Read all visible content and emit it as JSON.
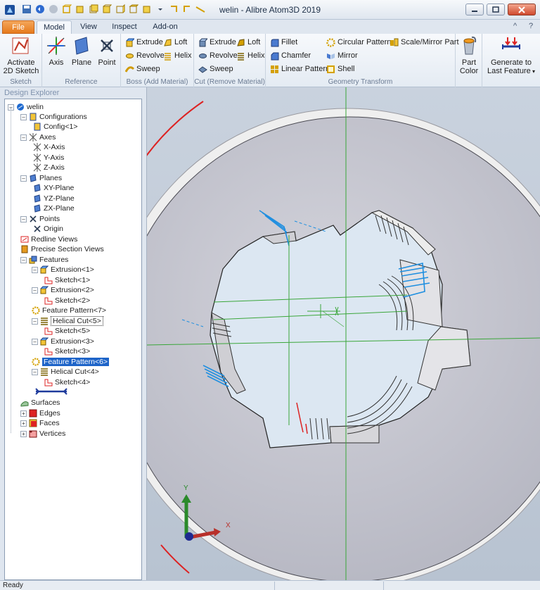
{
  "window": {
    "title": "welin - Alibre Atom3D 2019"
  },
  "tabs": [
    {
      "label": "File"
    },
    {
      "label": "Model"
    },
    {
      "label": "View"
    },
    {
      "label": "Inspect"
    },
    {
      "label": "Add-on"
    }
  ],
  "ribbon": {
    "help_glyph": "?",
    "minimize_glyph": "^",
    "sketch": {
      "label": "Sketch",
      "activate_line1": "Activate",
      "activate_line2": "2D Sketch"
    },
    "reference": {
      "label": "Reference",
      "axis": "Axis",
      "plane": "Plane",
      "point": "Point"
    },
    "boss": {
      "label": "Boss (Add Material)",
      "extrude": "Extrude",
      "loft": "Loft",
      "revolve": "Revolve",
      "helix": "Helix",
      "sweep": "Sweep"
    },
    "cut": {
      "label": "Cut (Remove Material)",
      "extrude": "Extrude",
      "loft": "Loft",
      "revolve": "Revolve",
      "helix": "Helix",
      "sweep": "Sweep"
    },
    "transform": {
      "label": "Geometry Transform",
      "fillet": "Fillet",
      "chamfer": "Chamfer",
      "linear_pattern": "Linear Pattern",
      "circular_pattern": "Circular Pattern",
      "mirror": "Mirror",
      "shell": "Shell",
      "scale_mirror": "Scale/Mirror Part"
    },
    "part_color_line1": "Part",
    "part_color_line2": "Color",
    "generate_line1": "Generate to",
    "generate_line2": "Last Feature"
  },
  "explorer": {
    "title": "Design Explorer",
    "items": [
      {
        "label": "welin"
      },
      {
        "label": "Configurations"
      },
      {
        "label": "Config<1>"
      },
      {
        "label": "Axes"
      },
      {
        "label": "X-Axis"
      },
      {
        "label": "Y-Axis"
      },
      {
        "label": "Z-Axis"
      },
      {
        "label": "Planes"
      },
      {
        "label": "XY-Plane"
      },
      {
        "label": "YZ-Plane"
      },
      {
        "label": "ZX-Plane"
      },
      {
        "label": "Points"
      },
      {
        "label": "Origin"
      },
      {
        "label": "Redline Views"
      },
      {
        "label": "Precise Section Views"
      },
      {
        "label": "Features"
      },
      {
        "label": "Extrusion<1>"
      },
      {
        "label": "Sketch<1>"
      },
      {
        "label": "Extrusion<2>"
      },
      {
        "label": "Sketch<2>"
      },
      {
        "label": "Feature Pattern<7>"
      },
      {
        "label": "Helical Cut<5>"
      },
      {
        "label": "Sketch<5>"
      },
      {
        "label": "Extrusion<3>"
      },
      {
        "label": "Sketch<3>"
      },
      {
        "label": "Feature Pattern<6>"
      },
      {
        "label": "Helical Cut<4>"
      },
      {
        "label": "Sketch<4>"
      },
      {
        "label": "Surfaces"
      },
      {
        "label": "Edges"
      },
      {
        "label": "Faces"
      },
      {
        "label": "Vertices"
      }
    ]
  },
  "viewport": {
    "triad_y": "Y",
    "triad_x": "X"
  },
  "status": {
    "text": "Ready"
  },
  "colors": {
    "accent": "#1e64c8",
    "file_tab": "#e67a1c",
    "selection": "#1e64c8",
    "axis_green": "#3aa63a",
    "edge_blue": "#1f8fe0"
  }
}
